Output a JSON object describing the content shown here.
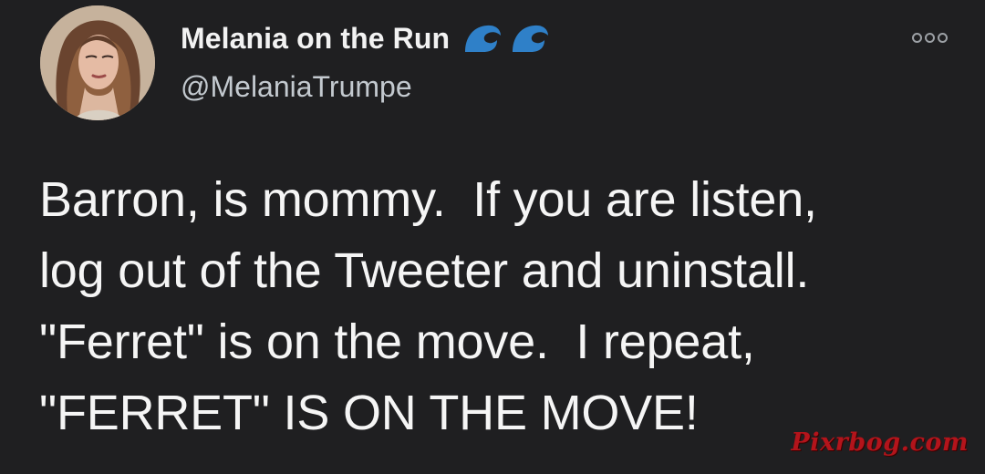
{
  "author": {
    "display_name": "Melania on the Run",
    "handle": "@MelaniaTrumpe",
    "badge_icons": [
      "wave-icon",
      "wave-icon"
    ],
    "avatar": "profile-photo"
  },
  "tweet": {
    "lines": [
      "Barron, is mommy.  If you are listen,",
      "log out of the Tweeter and uninstall.",
      "\"Ferret\" is on the move.  I repeat,",
      "\"FERRET\" IS ON THE MOVE!"
    ]
  },
  "actions": {
    "more_icon": "more-options-icon"
  },
  "watermark": {
    "text": "Pixrbog.com"
  },
  "colors": {
    "background": "#1f1f21",
    "primary_text": "#f5f5f5",
    "secondary_text": "#c3c9cf",
    "wave_icon": "#2f80c8",
    "watermark": "#b3141b"
  }
}
